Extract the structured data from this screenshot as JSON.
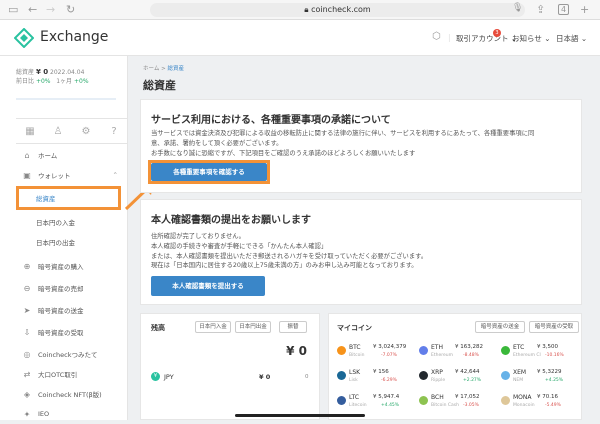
{
  "browser": {
    "url": "coincheck.com",
    "tab_count": "4"
  },
  "header": {
    "brand": "Exchange",
    "account_label": "取引アカウント",
    "notice_label": "お知らせ",
    "language_label": "日本語",
    "notif_count": "3"
  },
  "sidebar": {
    "balance_label": "総資産",
    "balance_value": "¥ 0",
    "balance_date": "2022.04.04",
    "change_label_1": "前日比",
    "change_value_1": "+0%",
    "change_label_2": "1ヶ月",
    "change_value_2": "+0%",
    "items": [
      {
        "label": "ホーム",
        "icon": "home-icon"
      },
      {
        "label": "ウォレット",
        "icon": "wallet-icon"
      },
      {
        "label": "総資産",
        "icon": ""
      },
      {
        "label": "日本円の入金",
        "icon": ""
      },
      {
        "label": "日本円の出金",
        "icon": ""
      },
      {
        "label": "暗号資産の購入",
        "icon": "buy-icon"
      },
      {
        "label": "暗号資産の売却",
        "icon": "sell-icon"
      },
      {
        "label": "暗号資産の送金",
        "icon": "send-icon"
      },
      {
        "label": "暗号資産の受取",
        "icon": "receive-icon"
      },
      {
        "label": "Coincheckつみたて",
        "icon": "tsumitate-icon"
      },
      {
        "label": "大口OTC取引",
        "icon": "otc-icon"
      },
      {
        "label": "Coincheck NFT(β版)",
        "icon": "nft-icon"
      },
      {
        "label": "IEO",
        "icon": "ieo-icon"
      }
    ]
  },
  "main": {
    "breadcrumb_home": "ホーム",
    "breadcrumb_sep": ">",
    "breadcrumb_current": "総資産",
    "page_title": "総資産",
    "card1": {
      "title": "サービス利用における、各種重要事項の承諾について",
      "line1": "当サービスでは資金決済及び犯罪による収益の移転防止に関する法律の施行に伴い、サービスを利用するにあたって、各種重要事項に同",
      "line2": "意、承諾、署約をして頂く必要がございます。",
      "line3": "お手数になり誠に恐縮ですが、下記項目をご確認のうえ承諾のほどよろしくお願いいたします",
      "button": "各種重要事項を確認する"
    },
    "card2": {
      "title": "本人確認書類の提出をお願いします",
      "line1": "住所確認が完了しておりません。",
      "line2": "本人確認の手続きや審査が手軽にできる「かんたん本人確認」",
      "line3": "または、本人確認書類を提出いただき郵送されるハガキを受け取っていただく必要がございます。",
      "line4": "現在は「日本国内に居住する20歳以上75歳未満の方」のみお申し込み可能となっております。",
      "button": "本人確認書類を提出する"
    },
    "balance_card": {
      "title": "残高",
      "deposit": "日本円入金",
      "withdraw": "日本円出金",
      "send": "振替",
      "total": "¥ 0",
      "jpy_label": "JPY",
      "jpy_value": "¥ 0",
      "jpy_extra": "0"
    },
    "mycoin_card": {
      "title": "マイコイン",
      "send_button": "暗号資産の送金",
      "receive_button": "暗号資産の受取",
      "coins": [
        {
          "symbol": "BTC",
          "price": "¥ 3,024,379",
          "name": "Bitcoin",
          "change": "-7.07%",
          "color": "#f7931a",
          "neg": true
        },
        {
          "symbol": "ETH",
          "price": "¥ 163,282",
          "name": "Ethereum",
          "change": "-8.48%",
          "color": "#627eea",
          "neg": true
        },
        {
          "symbol": "ETC",
          "price": "¥ 3,500",
          "name": "Ethereum Cl",
          "change": "-10.16%",
          "color": "#3ab83a",
          "neg": true
        },
        {
          "symbol": "LSK",
          "price": "¥ 156",
          "name": "Lisk",
          "change": "-6.29%",
          "color": "#1a6896",
          "neg": true
        },
        {
          "symbol": "XRP",
          "price": "¥ 42,644",
          "name": "Ripple",
          "change": "+2.27%",
          "color": "#23292f",
          "neg": false
        },
        {
          "symbol": "XEM",
          "price": "¥ 5,3229",
          "name": "NEM",
          "change": "+4.25%",
          "color": "#67b2e8",
          "neg": false
        },
        {
          "symbol": "LTC",
          "price": "¥ 5,947.4",
          "name": "Litecoin",
          "change": "+4.45%",
          "color": "#345d9d",
          "neg": false
        },
        {
          "symbol": "BCH",
          "price": "¥ 17,052",
          "name": "Bitcoin Cash",
          "change": "-3.05%",
          "color": "#8dc351",
          "neg": true
        },
        {
          "symbol": "MONA",
          "price": "¥ 70.16",
          "name": "Monacoin",
          "change": "-5.49%",
          "color": "#dec799",
          "neg": true
        }
      ]
    }
  },
  "colors": {
    "accent": "#3a86c8",
    "highlight": "#f39237",
    "logo": "#29c2a0"
  }
}
